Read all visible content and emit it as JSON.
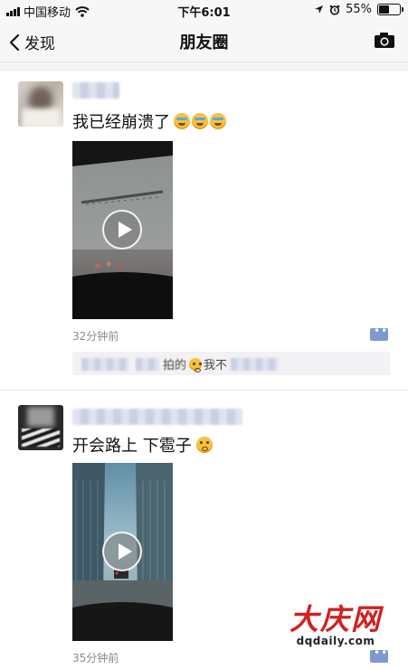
{
  "status_bar": {
    "carrier": "中国移动",
    "time": "下午6:01",
    "battery": "55%",
    "battery_level": 0.55
  },
  "nav": {
    "back_label": "发现",
    "title": "朋友圈"
  },
  "posts": [
    {
      "text": "我已经崩溃了",
      "emojis": [
        "cry-laugh",
        "cry-laugh",
        "cry-laugh"
      ],
      "time": "32分钟前",
      "comment": {
        "visible_text": "拍的",
        "visible_text_2": "我不"
      }
    },
    {
      "text": "开会路上 下雹子",
      "emojis": [
        "blush"
      ],
      "time": "35分钟前"
    }
  ],
  "watermark": {
    "title": "大庆网",
    "site": "dqdaily.com"
  },
  "colors": {
    "nav_bg": "#f7f7f7",
    "link_blue": "#7c9ad0",
    "watermark_red": "#d22020"
  }
}
